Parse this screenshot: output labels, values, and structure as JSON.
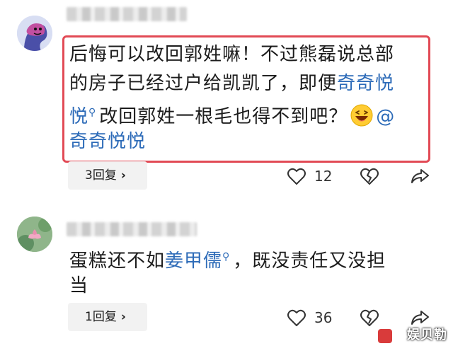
{
  "comments": [
    {
      "lines": [
        {
          "text": "后悔可以改回郭姓嘛！不过熊磊说总部"
        },
        {
          "text": "的房子已经过户给凯凯了，即便",
          "mention": "奇奇悦"
        },
        {
          "mention": "悦",
          "text": "改回郭姓一根毛也得不到吧？",
          "tail": "@"
        },
        {
          "mention": "奇奇悦悦"
        }
      ],
      "reply_label": "3回复",
      "likes": "12"
    },
    {
      "lines": [
        {
          "text": "蛋糕还不如",
          "mention": "姜甲儒",
          "tail": "，既没责任又没担"
        },
        {
          "text": "当"
        }
      ],
      "reply_label": "1回复",
      "likes": "36"
    }
  ],
  "icons": {
    "heart": "heart-outline-icon",
    "dislike": "broken-heart-icon",
    "share": "share-arrow-icon",
    "chevron": "chevron-right-icon",
    "emoji": "laughing-emoji-icon",
    "mention_marker": "search-q-icon"
  },
  "colors": {
    "highlight_border": "#e24a55",
    "mention": "#2d6bb8",
    "pill_bg": "#f2f2f2"
  },
  "watermark": "娱贝勒"
}
